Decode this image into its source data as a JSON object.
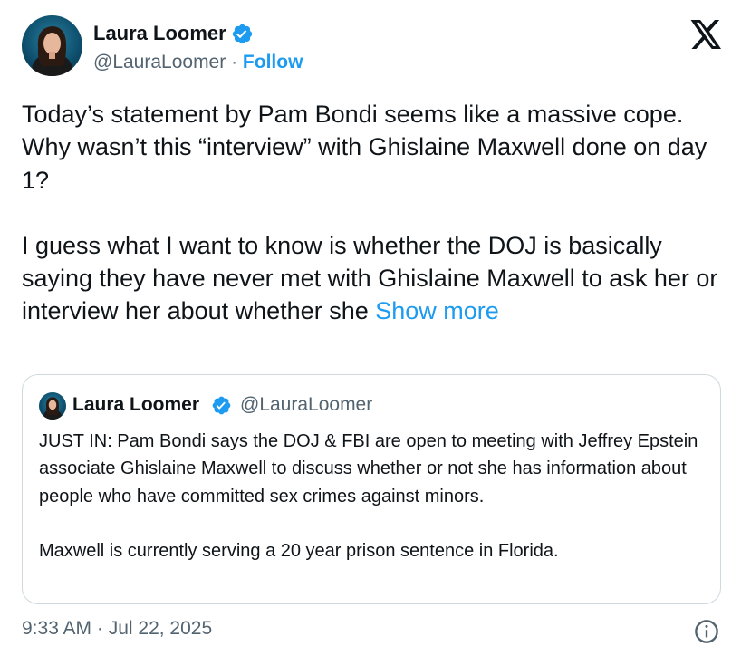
{
  "author": {
    "name": "Laura Loomer",
    "handle": "@LauraLoomer",
    "separator": "·",
    "follow_label": "Follow"
  },
  "tweet": {
    "paragraph_1": "Today’s statement by Pam Bondi seems like a massive cope. Why wasn’t this “interview” with Ghislaine Maxwell done on day 1?",
    "paragraph_2": "I guess what I want to know is whether the DOJ is basically saying they have never met with Ghislaine Maxwell to ask her or interview her about whether she",
    "show_more_label": "Show more"
  },
  "quoted_tweet": {
    "name": "Laura Loomer",
    "handle": "@LauraLoomer",
    "paragraph_1": "JUST IN: Pam Bondi says the DOJ & FBI are open to meeting with Jeffrey Epstein associate Ghislaine Maxwell to discuss whether or not she has information about people who have committed sex crimes against minors.",
    "paragraph_2": "Maxwell is currently serving a 20 year prison sentence in Florida."
  },
  "timestamp": "9:33 AM · Jul 22, 2025",
  "icons": {
    "verified": "verified-badge-icon",
    "x_logo": "x-logo-icon",
    "info": "info-icon"
  },
  "colors": {
    "accent": "#1d9bf0",
    "text": "#0f1419",
    "secondary": "#536471",
    "border": "#cfd9de"
  }
}
